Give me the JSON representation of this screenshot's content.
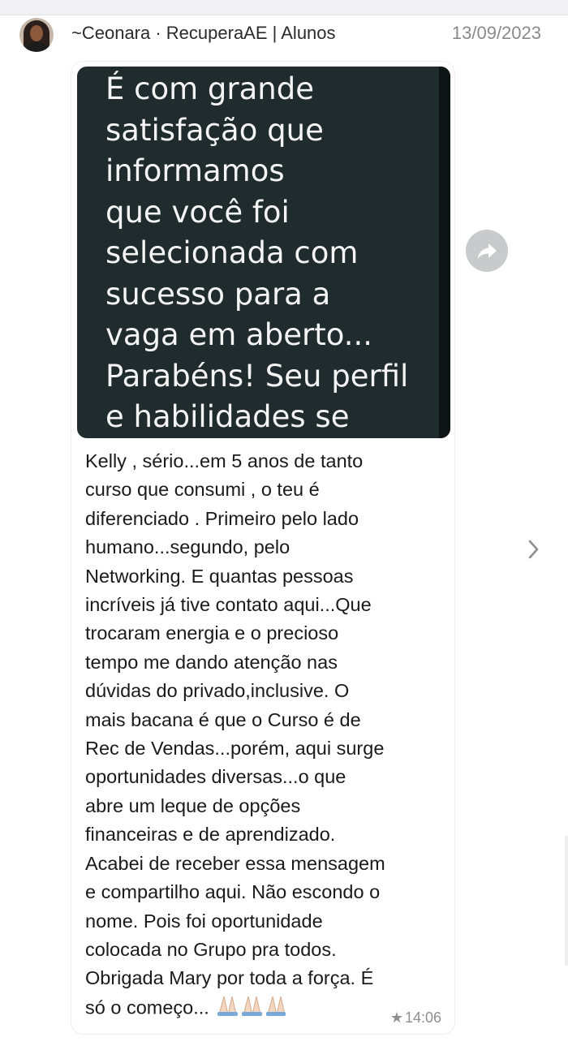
{
  "header": {
    "sender": "~Ceonara · RecuperaAE | Alunos",
    "date": "13/09/2023"
  },
  "media": {
    "text": "É com grande\nsatisfação que\ninformamos\nque você foi\nselecionada com\nsucesso para a\nvaga em aberto...\nParabéns! Seu perfil\ne habilidades se"
  },
  "message": {
    "text": "Kelly , sério...em 5 anos de tanto\ncurso que consumi , o teu é\ndiferenciado . Primeiro pelo lado\nhumano...segundo, pelo\nNetworking. E quantas pessoas\nincríveis já tive contato aqui...Que\ntrocaram energia e o precioso\ntempo me dando atenção nas\ndúvidas do privado,inclusive. O\nmais bacana é que o Curso é de\nRec de Vendas...porém, aqui surge\noportunidades diversas...o que\nabre um leque de opções\nfinanceiras e de aprendizado.\nAcabei de receber essa mensagem\ne compartilho aqui. Não escondo o\nnome. Pois foi oportunidade\ncolocada no Grupo pra todos.\nObrigada Mary por toda a força. É\nsó o começo...",
    "emojis": "🙏🏻🙏🏻🙏🏻",
    "time": "14:06",
    "starred": "★"
  },
  "icons": {
    "forward": "forward-arrow-icon",
    "chevron": "chevron-right-icon"
  }
}
